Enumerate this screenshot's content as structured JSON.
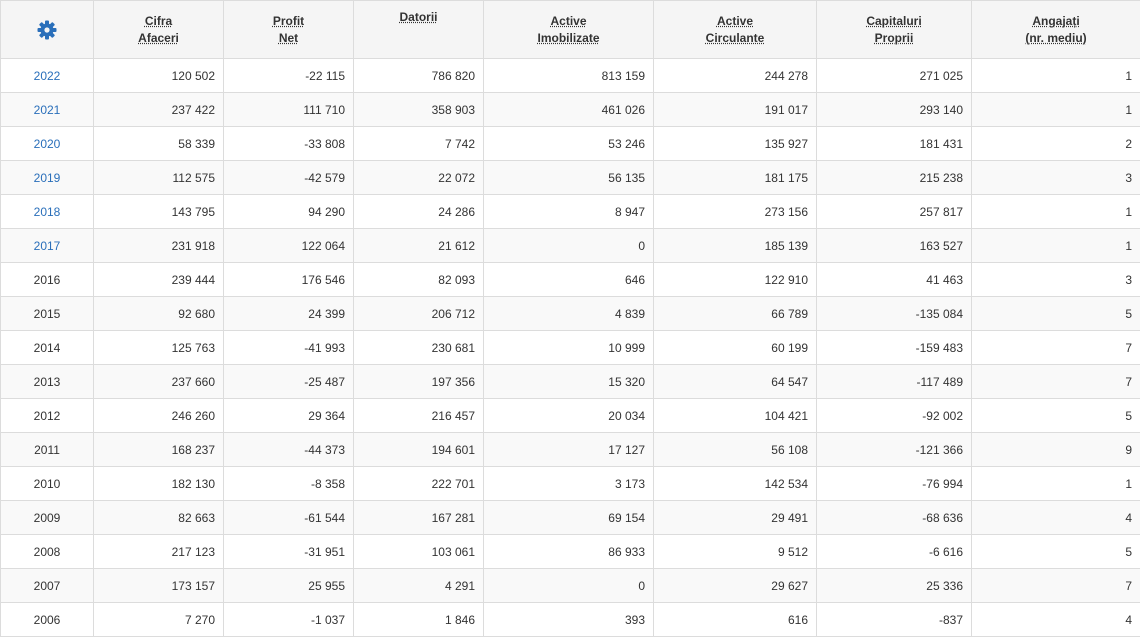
{
  "settings_icon": "gear-icon",
  "accent_color": "#2a6fba",
  "headers": [
    {
      "line1": "Cifra",
      "line2": "Afaceri"
    },
    {
      "line1": "Profit",
      "line2": "Net"
    },
    {
      "line1": "Datorii",
      "line2": ""
    },
    {
      "line1": "Active",
      "line2": "Imobilizate"
    },
    {
      "line1": "Active",
      "line2": "Circulante"
    },
    {
      "line1": "Capitaluri",
      "line2": "Proprii"
    },
    {
      "line1": "Angajați",
      "line2": "(nr. mediu)"
    }
  ],
  "rows": [
    {
      "year": "2022",
      "link": true,
      "cifra": "120 502",
      "profit": "-22 115",
      "datorii": "786 820",
      "imob": "813 159",
      "circ": "244 278",
      "cap": "271 025",
      "ang": "1"
    },
    {
      "year": "2021",
      "link": true,
      "cifra": "237 422",
      "profit": "111 710",
      "datorii": "358 903",
      "imob": "461 026",
      "circ": "191 017",
      "cap": "293 140",
      "ang": "1"
    },
    {
      "year": "2020",
      "link": true,
      "cifra": "58 339",
      "profit": "-33 808",
      "datorii": "7 742",
      "imob": "53 246",
      "circ": "135 927",
      "cap": "181 431",
      "ang": "2"
    },
    {
      "year": "2019",
      "link": true,
      "cifra": "112 575",
      "profit": "-42 579",
      "datorii": "22 072",
      "imob": "56 135",
      "circ": "181 175",
      "cap": "215 238",
      "ang": "3"
    },
    {
      "year": "2018",
      "link": true,
      "cifra": "143 795",
      "profit": "94 290",
      "datorii": "24 286",
      "imob": "8 947",
      "circ": "273 156",
      "cap": "257 817",
      "ang": "1"
    },
    {
      "year": "2017",
      "link": true,
      "cifra": "231 918",
      "profit": "122 064",
      "datorii": "21 612",
      "imob": "0",
      "circ": "185 139",
      "cap": "163 527",
      "ang": "1"
    },
    {
      "year": "2016",
      "link": false,
      "cifra": "239 444",
      "profit": "176 546",
      "datorii": "82 093",
      "imob": "646",
      "circ": "122 910",
      "cap": "41 463",
      "ang": "3"
    },
    {
      "year": "2015",
      "link": false,
      "cifra": "92 680",
      "profit": "24 399",
      "datorii": "206 712",
      "imob": "4 839",
      "circ": "66 789",
      "cap": "-135 084",
      "ang": "5"
    },
    {
      "year": "2014",
      "link": false,
      "cifra": "125 763",
      "profit": "-41 993",
      "datorii": "230 681",
      "imob": "10 999",
      "circ": "60 199",
      "cap": "-159 483",
      "ang": "7"
    },
    {
      "year": "2013",
      "link": false,
      "cifra": "237 660",
      "profit": "-25 487",
      "datorii": "197 356",
      "imob": "15 320",
      "circ": "64 547",
      "cap": "-117 489",
      "ang": "7"
    },
    {
      "year": "2012",
      "link": false,
      "cifra": "246 260",
      "profit": "29 364",
      "datorii": "216 457",
      "imob": "20 034",
      "circ": "104 421",
      "cap": "-92 002",
      "ang": "5"
    },
    {
      "year": "2011",
      "link": false,
      "cifra": "168 237",
      "profit": "-44 373",
      "datorii": "194 601",
      "imob": "17 127",
      "circ": "56 108",
      "cap": "-121 366",
      "ang": "9"
    },
    {
      "year": "2010",
      "link": false,
      "cifra": "182 130",
      "profit": "-8 358",
      "datorii": "222 701",
      "imob": "3 173",
      "circ": "142 534",
      "cap": "-76 994",
      "ang": "1"
    },
    {
      "year": "2009",
      "link": false,
      "cifra": "82 663",
      "profit": "-61 544",
      "datorii": "167 281",
      "imob": "69 154",
      "circ": "29 491",
      "cap": "-68 636",
      "ang": "4"
    },
    {
      "year": "2008",
      "link": false,
      "cifra": "217 123",
      "profit": "-31 951",
      "datorii": "103 061",
      "imob": "86 933",
      "circ": "9 512",
      "cap": "-6 616",
      "ang": "5"
    },
    {
      "year": "2007",
      "link": false,
      "cifra": "173 157",
      "profit": "25 955",
      "datorii": "4 291",
      "imob": "0",
      "circ": "29 627",
      "cap": "25 336",
      "ang": "7"
    },
    {
      "year": "2006",
      "link": false,
      "cifra": "7 270",
      "profit": "-1 037",
      "datorii": "1 846",
      "imob": "393",
      "circ": "616",
      "cap": "-837",
      "ang": "4"
    }
  ]
}
